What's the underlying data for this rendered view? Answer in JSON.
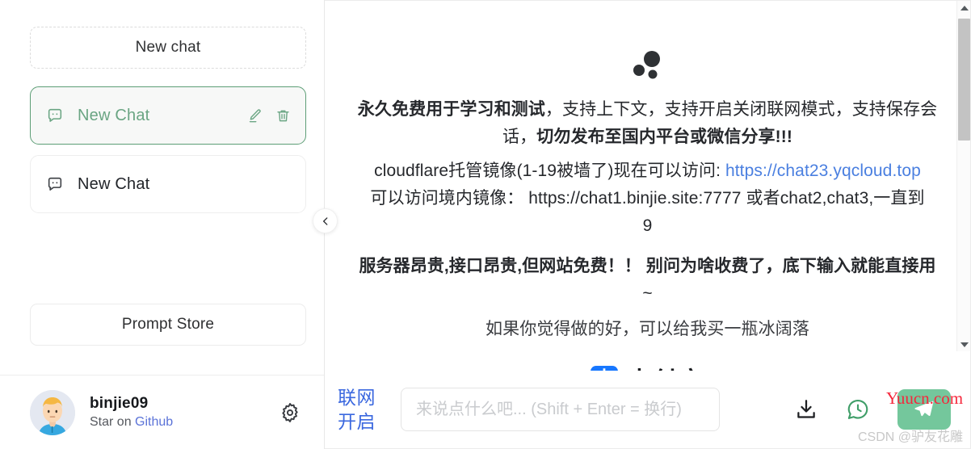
{
  "sidebar": {
    "new_chat_label": "New chat",
    "chats": [
      {
        "label": "New Chat",
        "selected": true
      },
      {
        "label": "New Chat",
        "selected": false
      }
    ],
    "prompt_store_label": "Prompt Store",
    "user": {
      "name": "binjie09",
      "sub_prefix": "Star on ",
      "sub_link": "Github"
    }
  },
  "main": {
    "messages": {
      "line1_bold": "永久免费用于学习和测试",
      "line1_rest": "，支持上下文，支持开启关闭联网模式，支持保存会",
      "line2_rest": "话，",
      "line2_bold": "切勿发布至国内平台或微信分享!!!",
      "line3_prefix": "cloudflare托管镜像(1-19被墙了)现在可以访问: ",
      "line3_link": "https://chat23.yqcloud.top",
      "line4": "可以访问境内镜像： https://chat1.binjie.site:7777 或者chat2,chat3,一直到",
      "line5": "9",
      "line6": "服务器昂贵,接口昂贵,但网站免费！！ 别问为啥收费了，底下输入就能直接用",
      "line7": "~",
      "line8": "如果你觉得做的好，可以给我买一瓶冰阔落"
    },
    "alipay": {
      "mark_glyph": "支",
      "text": "支付宝"
    }
  },
  "composer": {
    "net_toggle_line1": "联网",
    "net_toggle_line2": "开启",
    "input_value": "",
    "input_placeholder": "来说点什么吧... (Shift + Enter = 换行)"
  },
  "watermarks": {
    "yuucn": "Yuucn.com",
    "csdn": "CSDN @驴友花雕"
  },
  "colors": {
    "accent_green": "#74c79c",
    "selected_border": "#5d9e76",
    "link_blue": "#4a7fe0",
    "net_blue": "#3b68df",
    "alipay_blue": "#1777ff"
  }
}
